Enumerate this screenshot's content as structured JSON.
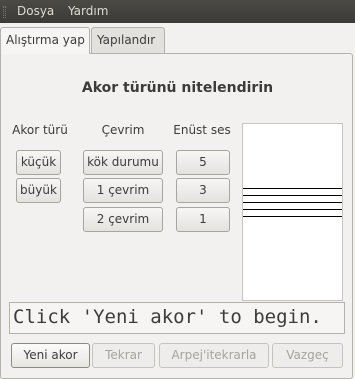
{
  "menubar": {
    "items": [
      "Dosya",
      "Yardım"
    ]
  },
  "tabs": [
    {
      "label": "Alıştırma yap",
      "active": true
    },
    {
      "label": "Yapılandır",
      "active": false
    }
  ],
  "exercise": {
    "title": "Akor türünü nitelendirin",
    "chord_type": {
      "header": "Akor türü",
      "options": [
        "küçük",
        "büyük"
      ]
    },
    "inversion": {
      "header": "Çevrim",
      "options": [
        "kök durumu",
        "1 çevrim",
        "2 çevrim"
      ]
    },
    "top_note": {
      "header": "Enüst ses",
      "options": [
        "5",
        "3",
        "1"
      ]
    }
  },
  "staff": {
    "lines": 5
  },
  "status_text": "Click 'Yeni akor' to begin.",
  "actions": {
    "new_chord": "Yeni akor",
    "repeat": "Tekrar",
    "arpeggio": "Arpej'itekrarla",
    "give_up": "Vazgeç"
  }
}
